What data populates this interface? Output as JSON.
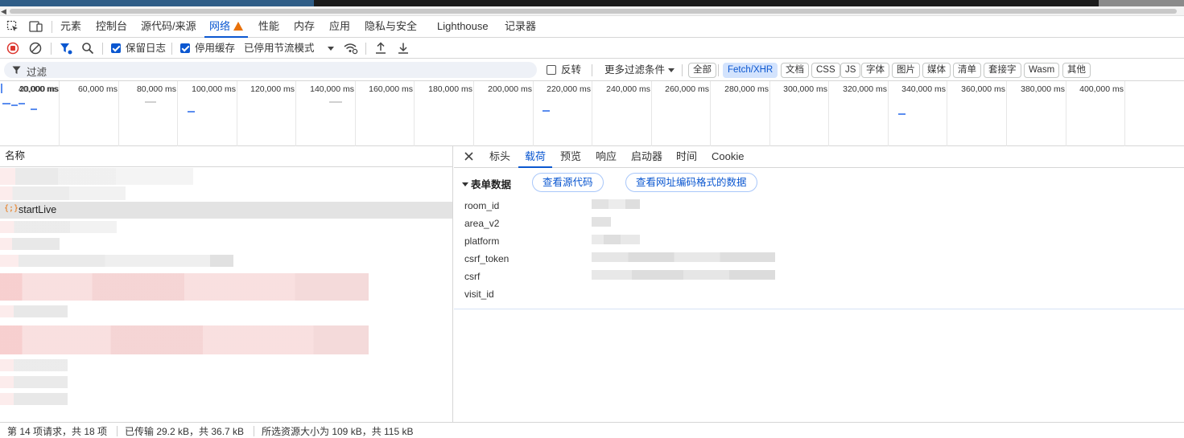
{
  "main_tabs": {
    "elements": "元素",
    "console": "控制台",
    "sources": "源代码/来源",
    "network": "网络",
    "performance": "性能",
    "memory": "内存",
    "application": "应用",
    "privacy": "隐私与安全",
    "lighthouse": "Lighthouse",
    "recorder": "记录器"
  },
  "toolbar": {
    "preserve_log": "保留日志",
    "preserve_log_checked": true,
    "disable_cache": "停用缓存",
    "disable_cache_checked": true,
    "throttling": "已停用节流模式"
  },
  "filter_bar": {
    "filter_placeholder": "过滤",
    "invert": "反转",
    "invert_checked": false,
    "more_filters": "更多过滤条件",
    "types": [
      "全部",
      "Fetch/XHR",
      "文档",
      "CSS",
      "JS",
      "字体",
      "图片",
      "媒体",
      "清单",
      "套接字",
      "Wasm",
      "其他"
    ],
    "active_type": "Fetch/XHR"
  },
  "overview": {
    "ticks": [
      "20,000 ms",
      "40,000 ms",
      "60,000 ms",
      "80,000 ms",
      "100,000 ms",
      "120,000 ms",
      "140,000 ms",
      "160,000 ms",
      "180,000 ms",
      "200,000 ms",
      "220,000 ms",
      "240,000 ms",
      "260,000 ms",
      "280,000 ms",
      "300,000 ms",
      "320,000 ms",
      "340,000 ms",
      "360,000 ms",
      "380,000 ms",
      "400,000 ms"
    ]
  },
  "request_list": {
    "column_name": "名称",
    "selected_request": "startLive"
  },
  "detail": {
    "tabs": {
      "headers": "标头",
      "payload": "载荷",
      "preview": "预览",
      "response": "响应",
      "initiator": "启动器",
      "timing": "时间",
      "cookie": "Cookie"
    },
    "section_title": "表单数据",
    "view_source": "查看源代码",
    "view_url_encoded": "查看网址编码格式的数据",
    "fields": [
      "room_id",
      "area_v2",
      "platform",
      "csrf_token",
      "csrf",
      "visit_id"
    ]
  },
  "status": {
    "requests": "第 14 项请求，共 18 项",
    "transferred": "已传输 29.2 kB，共 36.7 kB",
    "resources": "所选资源大小为 109 kB，共 115 kB"
  },
  "colors": {
    "accent": "#0b57d0",
    "warning": "#e8710a",
    "record": "#dc362e"
  }
}
